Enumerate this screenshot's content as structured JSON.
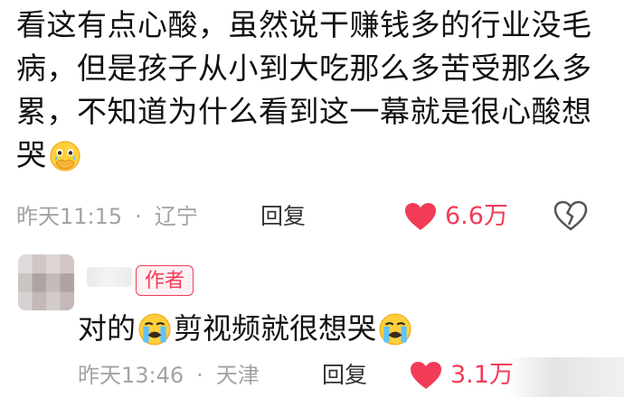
{
  "comment": {
    "text": "看这有点心酸，虽然说干赚钱多的行业没毛病，但是孩子从小到大吃那么多苦受那么多累，不知道为什么看到这一幕就是很心酸想哭",
    "emoji": "holding-back-tears-emoji",
    "time": "昨天11:15",
    "separator": "·",
    "location": "辽宁",
    "reply_label": "回复",
    "likes": "6.6万",
    "like_color": "#f23c57"
  },
  "reply": {
    "author_badge": "作者",
    "text_part1": "对的",
    "text_part2": "剪视频就很想哭",
    "emoji": "loudly-crying-face-emoji",
    "time": "昨天13:46",
    "separator": "·",
    "location": "天津",
    "reply_label": "回复",
    "likes": "3.1万"
  }
}
